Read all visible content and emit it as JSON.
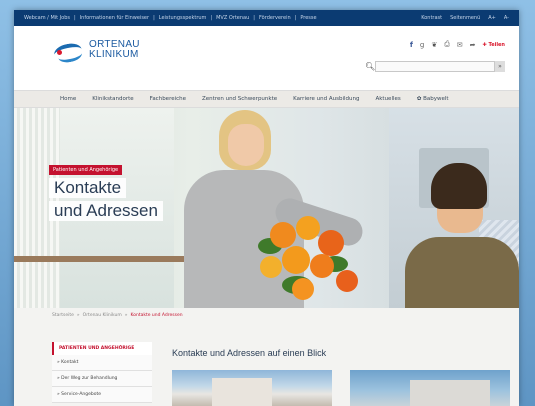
{
  "topbar": {
    "links": [
      "Webcam / Mit Jobs",
      "Informationen für Einweiser",
      "Leistungsspektrum",
      "MVZ Ortenau",
      "Förderverein",
      "Presse"
    ],
    "right": [
      "Kontrast",
      "Seitenmenü",
      "A+",
      "A-"
    ]
  },
  "header": {
    "logo_line1": "ORTENAU",
    "logo_line2": "KLINIKUM",
    "social": [
      "f",
      "g+",
      "t",
      "print",
      "mail",
      "rss"
    ],
    "share_label": "✚ Teilen",
    "search_placeholder": "",
    "search_icon": "search-icon"
  },
  "nav": {
    "items": [
      "Home",
      "Klinikstandorte",
      "Fachbereiche",
      "Zentren und Schwerpunkte",
      "Karriere und Ausbildung",
      "Aktuelles",
      "Babywelt"
    ]
  },
  "hero": {
    "tag": "Patienten und Angehörige",
    "title_line1": "Kontakte",
    "title_line2": "und Adressen"
  },
  "breadcrumb": {
    "items": [
      "Startseite",
      "Ortenau Klinikum",
      "Kontakte und Adressen"
    ]
  },
  "sidebar": {
    "title": "PATIENTEN UND ANGEHÖRIGE",
    "items": [
      "» Kontakt",
      "» Der Weg zur Behandlung",
      "» Service-Angebote"
    ]
  },
  "main": {
    "heading": "Kontakte und Adressen auf einen Blick"
  },
  "colors": {
    "brand_blue": "#0b3b72",
    "accent_red": "#c4122f",
    "logo_blue": "#1b5aa0"
  }
}
